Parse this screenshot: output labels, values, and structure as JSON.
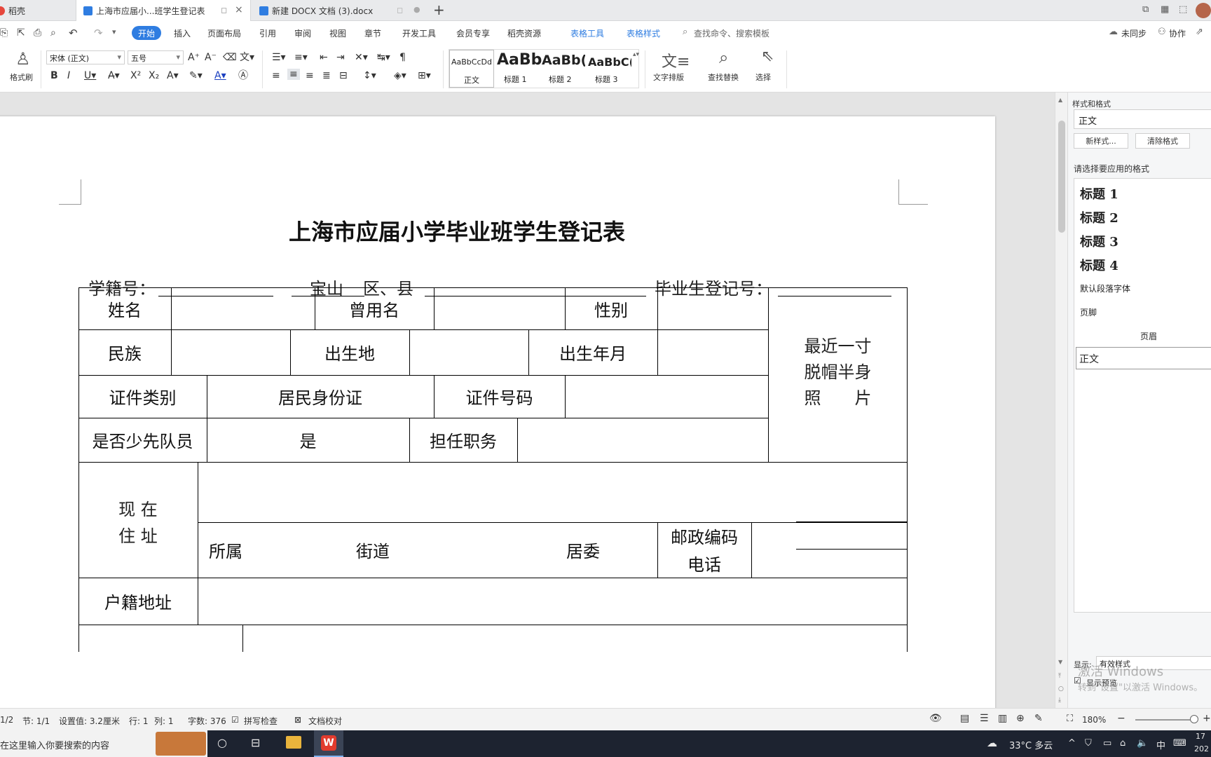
{
  "tabs": [
    {
      "label": "稻壳"
    },
    {
      "label": "上海市应届小...班学生登记表"
    },
    {
      "label": "新建 DOCX 文档 (3).docx"
    }
  ],
  "menu": {
    "items": [
      "开始",
      "插入",
      "页面布局",
      "引用",
      "审阅",
      "视图",
      "章节",
      "开发工具",
      "会员专享",
      "稻壳资源"
    ],
    "context_items": [
      "表格工具",
      "表格样式"
    ],
    "search": "查找命令、搜索模板",
    "sync": "未同步",
    "collab": "协作"
  },
  "ribbon": {
    "format_painter": "格式刷",
    "font_name": "宋体 (正文)",
    "font_size": "五号",
    "styles": [
      {
        "preview": "AaBbCcDd",
        "label": "正文"
      },
      {
        "preview": "AaBb",
        "label": "标题 1"
      },
      {
        "preview": "AaBb(",
        "label": "标题 2"
      },
      {
        "preview": "AaBbC(",
        "label": "标题 3"
      }
    ],
    "text_layout": "文字排版",
    "find_replace": "查找替换",
    "select": "选择"
  },
  "document": {
    "title": "上海市应届小学毕业班学生登记表",
    "header_line": {
      "student_id": "学籍号：",
      "district": "宝山",
      "district_suffix": "区、县",
      "grad_no": "毕业生登记号："
    },
    "table": {
      "name": "姓名",
      "former_name": "曾用名",
      "gender": "性别",
      "ethnicity": "民族",
      "birthplace": "出生地",
      "birth_date": "出生年月",
      "id_type": "证件类别",
      "id_type_value": "居民身份证",
      "id_number": "证件号码",
      "young_pioneer": "是否少先队员",
      "young_pioneer_value": "是",
      "position": "担任职务",
      "photo_line1": "最近一寸",
      "photo_line2": "脱帽半身",
      "photo_line3": "照　　片",
      "address_line1": "现 在",
      "address_line2": "住 址",
      "belong": "所属",
      "street": "街道",
      "committee": "居委",
      "postal": "邮政编码",
      "phone": "电话",
      "household": "户籍地址"
    }
  },
  "panel": {
    "title": "样式和格式",
    "current": "正文",
    "new_style": "新样式...",
    "clear_format": "清除格式",
    "choose_label": "请选择要应用的格式",
    "styles": [
      "标题 1",
      "标题 2",
      "标题 3",
      "标题 4",
      "默认段落字体",
      "页脚",
      "页眉",
      "正文"
    ],
    "show_label": "显示:",
    "show_value": "有效样式",
    "preview_label": "显示预览",
    "watermark1": "激活 Windows",
    "watermark2": "转到\"设置\"以激活 Windows。"
  },
  "status": {
    "page": "1/2",
    "section": "节: 1/1",
    "setting": "设置值: 3.2厘米",
    "row": "行: 1",
    "col": "列: 1",
    "words": "字数: 376",
    "spell": "拼写检查",
    "proof": "文档校对",
    "zoom": "180%"
  },
  "taskbar": {
    "search": "在这里输入你要搜索的内容",
    "weather": "33°C 多云",
    "ime": "中",
    "time": "17",
    "date": "202"
  },
  "colors": {
    "accent": "#2f7de1",
    "active_tab_pill": "#2f7de1",
    "taskbar": "#1d2330"
  }
}
